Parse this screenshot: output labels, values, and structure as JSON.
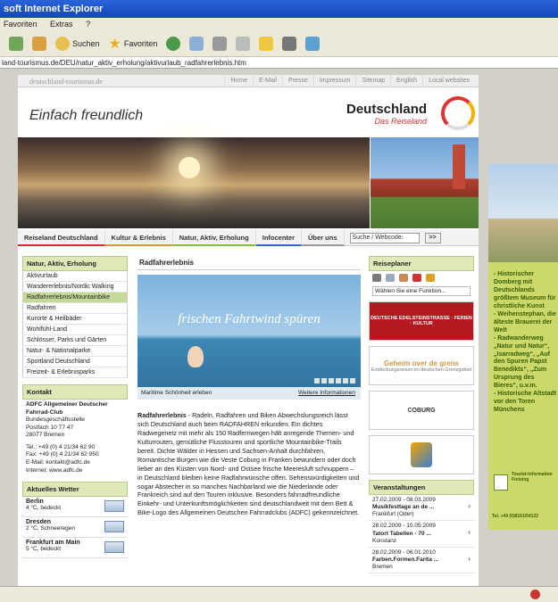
{
  "window": {
    "title": "soft Internet Explorer"
  },
  "menubar": {
    "items": [
      "Favoriten",
      "Extras",
      "?"
    ]
  },
  "toolbar": {
    "search_label": "Suchen",
    "favorites_label": "Favoriten"
  },
  "address": {
    "url": "land-tourismus.de/DEU/natur_aktiv_erholung/aktivurlaub_radfahrerlebnis.htm"
  },
  "site": {
    "brand": "deutschland-tourismus.de",
    "top_links": [
      "Home",
      "E-Mail",
      "Presse",
      "Impressum",
      "Sitemap",
      "English",
      "Local websites"
    ],
    "slogan": "Einfach freundlich",
    "logo_title": "Deutschland",
    "logo_sub": "Das Reiseland"
  },
  "nav": {
    "tabs": [
      "Reiseland Deutschland",
      "Kultur & Erlebnis",
      "Natur, Aktiv, Erholung",
      "Infocenter",
      "Über uns"
    ],
    "search_placeholder": "Suche / Webcode:",
    "go": ">>"
  },
  "left": {
    "menu_title": "Natur, Aktiv, Erholung",
    "menu": [
      "Aktivurlaub",
      "Wandererlebnis/Nordic Walking",
      "Radfahrerlebnis/Mountainbike",
      "Radfahren",
      "Kurorte & Heilbäder",
      "Wohlfühl-Land",
      "Schlösser, Parks und Gärten",
      "Natur- & Nationalparke",
      "Sportland Deutschland",
      "Freizeit- & Erlebnisparks"
    ],
    "kontakt_title": "Kontakt",
    "kontakt_org": "ADFC Allgemeiner Deutscher Fahrrad-Club",
    "kontakt_lines": [
      "Bundesgeschäftsstelle",
      "Postfach 10 77 47",
      "28077 Bremen",
      "",
      "Tel.: +49 (0) 4 21/34 62 90",
      "Fax: +49 (0) 4 21/34 62 950",
      "E-Mail: kontakt@adfc.de",
      "Internet: www.adfc.de"
    ],
    "wetter_title": "Aktuelles Wetter",
    "wetter": [
      {
        "city": "Berlin",
        "desc": "4 °C, bedeckt"
      },
      {
        "city": "Dresden",
        "desc": "2 °C, Schneeregen"
      },
      {
        "city": "Frankfurt am Main",
        "desc": "5 °C, bedeckt"
      }
    ]
  },
  "center": {
    "title": "Radfahrerlebnis",
    "teaser_slogan": "frischen Fahrtwind spüren",
    "caption_left": "Maritime Schönheit erleben",
    "caption_right": "Weitere Informationen",
    "lead": "Radfahrerlebnis",
    "text": " - Radeln, Radfahren und Biken Abwechslungsreich lässt sich Deutschland auch beim RADFAHREN erkunden: Ein dichtes Radwegenetz mit mehr als 150 Radfernwegen hält anregende Themen- und Kulturrouten, gemütliche Flusstouren und sportliche Mountainbike-Trails bereit. Dichte Wälder in Hessen und Sachsen-Anhalt durchfahren, Romantische Burgen wie die Veste Coburg in Franken bewundern oder doch lieber an den Küsten von Nord- und Ostsee frische Meeresluft schnuppern – in Deutschland bleiben keine Radfahrwünsche offen. Sehenswürdigkeiten und sogar Abstecher in so manches Nachbarland wie die Niederlande oder Frankreich sind auf den Touren inklusive. Besonders fahrradfreundliche Einkehr- und Unterkunftsmöglichkeiten sind deutschlandweit mit dem Bett & Bike-Logo des Allgemeinen Deutschen Fahrradclubs (ADFC) gekennzeichnet."
  },
  "right": {
    "planer_title": "Reiseplaner",
    "planer_select": "Wählen Sie eine Funktion...",
    "red_ad": "DEUTSCHE EDELSTEINSTRASSE · FERIEN · KULTUR",
    "geheim": "Geheim over de grens",
    "geheim_sub": "Entdeckungsreisen im deutschen Grenzgebiet",
    "coburg": "COBURG",
    "events_title": "Veranstaltungen",
    "events": [
      {
        "date": "27.02.2009 - 08.03.2009",
        "name": "Musikfesttage an de ...",
        "place": "Frankfurt (Oder)"
      },
      {
        "date": "28.02.2009 - 10.05.2009",
        "name": "Tatort Tabellen - 70 ...",
        "place": "Konstanz"
      },
      {
        "date": "28.02.2009 - 06.01.2010",
        "name": "Farben.Formen.Farita ...",
        "place": "Bremen"
      }
    ]
  },
  "sidebar_ad": {
    "lines": [
      "- Historischer Domberg mit Deutschlands größtem Museum für christliche Kunst",
      "- Weihenstephan, die älteste Brauerei der Welt",
      "- Radwanderweg „Natur und Natur“, „Isarradweg“, „Auf den Spuren Papst Benedikts“, „Zum Ursprung des Bieres“, u.v.m.",
      "- Historische Altstadt vor den Toren Münchens"
    ],
    "tourist": "Tourist-Information Freising",
    "tel": "Tel. +49 (0)8161/54122"
  }
}
